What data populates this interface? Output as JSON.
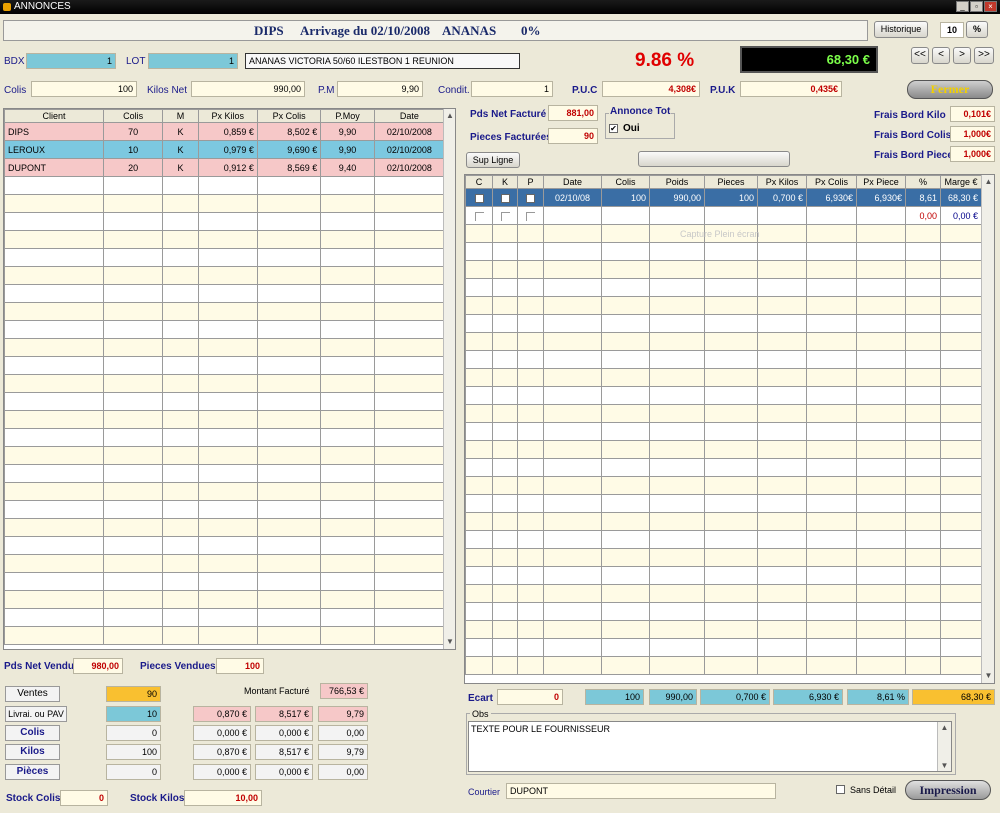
{
  "window": {
    "title": "ANNONCES",
    "min": "_",
    "max": "▫",
    "close": "×"
  },
  "header": {
    "client": "DIPS",
    "arrivage": "Arrivage du 02/10/2008",
    "product": "ANANAS",
    "pct": "0%",
    "historique": "Historique",
    "hist_value": "10",
    "pct_button": "%"
  },
  "lot_row": {
    "bdx_label": "BDX",
    "bdx_value": "1",
    "lot_label": "LOT",
    "lot_value": "1",
    "desc": "ANANAS VICTORIA 50/60 ILESTBON 1 REUNION",
    "margin_pct": "9.86 %",
    "total_display": "68,30 €"
  },
  "nav": {
    "first": "<<",
    "prev": "<",
    "next": ">",
    "last": ">>",
    "fermer": "Fermer"
  },
  "row2": {
    "colis_label": "Colis",
    "colis_value": "100",
    "kilos_label": "Kilos Net",
    "kilos_value": "990,00",
    "pm_label": "P.M",
    "pm_value": "9,90",
    "condit_label": "Condit.",
    "condit_value": "1",
    "puc_label": "P.U.C",
    "puc_value": "4,308€",
    "puk_label": "P.U.K",
    "puk_value": "0,435€"
  },
  "left_table": {
    "headers": [
      "Client",
      "Colis",
      "M",
      "Px Kilos",
      "Px Colis",
      "P.Moy",
      "Date"
    ],
    "rows": [
      [
        "DIPS",
        "70",
        "K",
        "0,859 €",
        "8,502 €",
        "9,90",
        "02/10/2008"
      ],
      [
        "LEROUX",
        "10",
        "K",
        "0,979 €",
        "9,690 €",
        "9,90",
        "02/10/2008"
      ],
      [
        "DUPONT",
        "20",
        "K",
        "0,912 €",
        "8,569 €",
        "9,40",
        "02/10/2008"
      ]
    ]
  },
  "mid": {
    "pds_net_label": "Pds Net Facturé",
    "pds_net_value": "881,00",
    "pieces_label": "Pieces Facturées",
    "pieces_value": "90",
    "annonce_label": "Annonce Tot",
    "oui_label": "Oui",
    "sup_ligne": "Sup Ligne"
  },
  "frais": {
    "kilo_label": "Frais Bord Kilo",
    "kilo_value": "0,101€",
    "colis_label": "Frais Bord Colis",
    "colis_value": "1,000€",
    "piece_label": "Frais Bord Piece",
    "piece_value": "1,000€"
  },
  "right_table": {
    "headers": [
      "C",
      "K",
      "P",
      "Date",
      "Colis",
      "Poids",
      "Pieces",
      "Px Kilos",
      "Px Colis",
      "Px Piece",
      "%",
      "Marge €"
    ],
    "row1": [
      "02/10/08",
      "100",
      "990,00",
      "100",
      "0,700 €",
      "6,930€",
      "6,930€",
      "8,61",
      "68,30 €"
    ],
    "row2": [
      "0,00",
      "0,00 €"
    ],
    "watermark": "Capture Plein écran"
  },
  "bottom_left": {
    "pds_vendu_label": "Pds Net Vendu",
    "pds_vendu_value": "980,00",
    "pieces_vendues_label": "Pieces Vendues",
    "pieces_vendues_value": "100",
    "montant_label": "Montant Facturé",
    "montant_value": "766,53 €",
    "ventes_label": "Ventes",
    "ventes_value": "90",
    "livrai_label": "Livrai. ou PAV",
    "livrai_value": "10",
    "livrai_vals": [
      "0,870 €",
      "8,517 €",
      "9,79"
    ],
    "colis_label": "Colis",
    "colis_value": "0",
    "colis_vals": [
      "0,000 €",
      "0,000 €",
      "0,00"
    ],
    "kilos_label": "Kilos",
    "kilos_value": "100",
    "kilos_vals": [
      "0,870 €",
      "8,517 €",
      "9,79"
    ],
    "pieces_label": "Pièces",
    "pieces_value": "0",
    "pieces_vals": [
      "0,000 €",
      "0,000 €",
      "0,00"
    ],
    "stock_colis_label": "Stock Colis",
    "stock_colis_value": "0",
    "stock_kilos_label": "Stock Kilos",
    "stock_kilos_value": "10,00"
  },
  "bottom_right": {
    "ecart_label": "Ecart",
    "ecart_value": "0",
    "totals": [
      "100",
      "990,00",
      "0,700 €",
      "6,930 €",
      "8,61 %",
      "68,30 €"
    ],
    "obs_label": "Obs",
    "obs_text": "TEXTE POUR LE FOURNISSEUR",
    "courtier_label": "Courtier",
    "courtier_value": "DUPONT",
    "sans_detail": "Sans Détail",
    "impression": "Impression"
  },
  "colors": {
    "cyan": "#7cc8d8",
    "pink": "#f6c8c8",
    "selected": "#3a6ea5",
    "accent_red": "#e00000",
    "lcd_green": "#7cff4a"
  }
}
